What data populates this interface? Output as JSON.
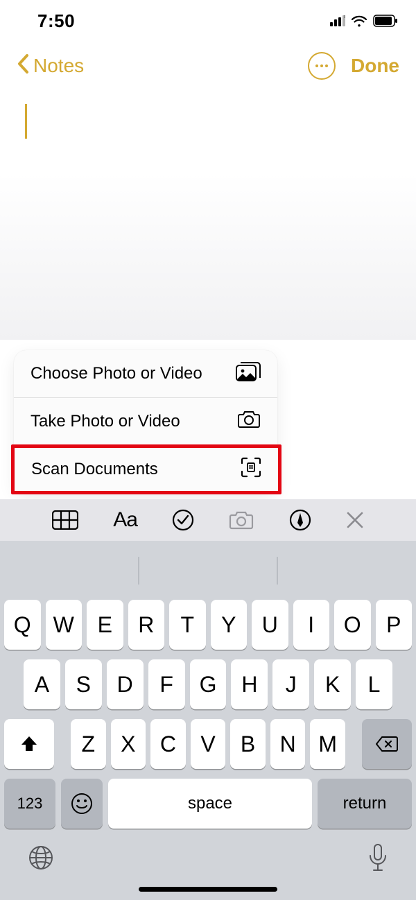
{
  "status": {
    "time": "7:50"
  },
  "nav": {
    "back_label": "Notes",
    "done_label": "Done"
  },
  "popup": {
    "choose_label": "Choose Photo or Video",
    "take_label": "Take Photo or Video",
    "scan_label": "Scan Documents"
  },
  "format_bar": {
    "aa_label": "Aa"
  },
  "keyboard": {
    "row1": [
      "Q",
      "W",
      "E",
      "R",
      "T",
      "Y",
      "U",
      "I",
      "O",
      "P"
    ],
    "row2": [
      "A",
      "S",
      "D",
      "F",
      "G",
      "H",
      "J",
      "K",
      "L"
    ],
    "row3": [
      "Z",
      "X",
      "C",
      "V",
      "B",
      "N",
      "M"
    ],
    "numbers_label": "123",
    "space_label": "space",
    "return_label": "return"
  }
}
